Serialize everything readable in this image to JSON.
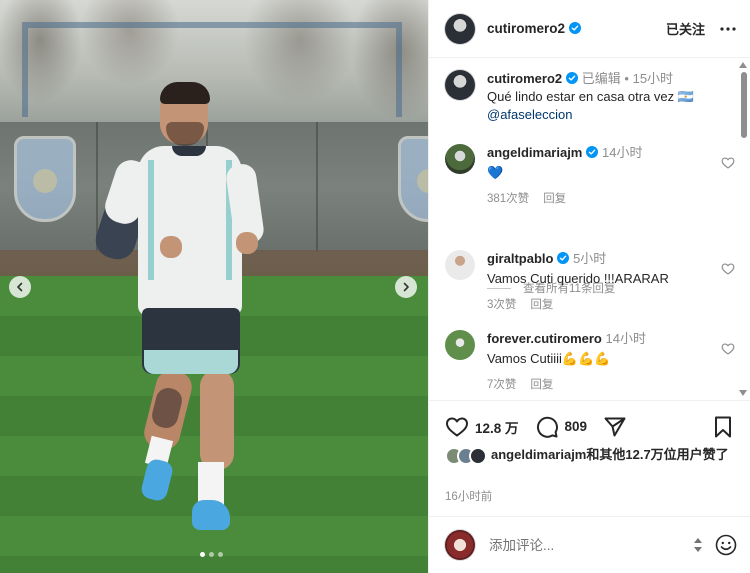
{
  "post": {
    "photo_alt": "",
    "carousel": {
      "count": 3,
      "active_index": 0
    }
  },
  "header": {
    "username": "cutiromero2",
    "follow_label": "已关注",
    "more_icon": "more-horizontal-icon"
  },
  "caption": {
    "username": "cutiromero2",
    "edited": "已编辑",
    "separator": "•",
    "time": "15小时",
    "text": "Qué lindo estar en casa otra vez 🇦🇷",
    "mention": "@afaseleccion"
  },
  "comments": [
    {
      "username": "angeldimariajm",
      "time": "14小时",
      "text": "💙",
      "likes": "381次赞",
      "reply": "回复",
      "verified": true
    },
    {
      "username": "giraltpablo",
      "time": "5小时",
      "text": "Vamos Cuti querido !!!ARARAR",
      "likes": "3次赞",
      "reply": "回复",
      "verified": true
    },
    {
      "username": "forever.cutiromero",
      "time": "14小时",
      "text": "Vamos Cutiiii💪💪💪",
      "likes": "7次赞",
      "reply": "回复",
      "verified": false
    }
  ],
  "view_replies": "查看所有11条回复",
  "actions": {
    "like_count": "12.8 万",
    "comment_count": "809"
  },
  "likes_summary": {
    "text": "angeldimariajm和其他12.7万位用户赞了"
  },
  "post_time": "16小时前",
  "composer": {
    "placeholder": "添加评论..."
  },
  "colors": {
    "verified": "#0095f6",
    "text": "#262626",
    "muted": "#8e8e8e",
    "mention": "#00376b"
  }
}
